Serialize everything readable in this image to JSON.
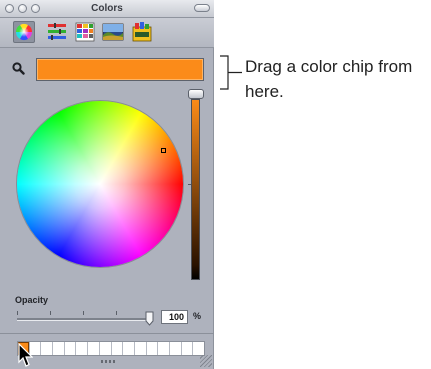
{
  "window": {
    "title": "Colors"
  },
  "toolbar": {
    "tabs": [
      {
        "name": "color-wheel",
        "icon": "color-wheel-icon",
        "selected": true
      },
      {
        "name": "color-sliders",
        "icon": "color-sliders-icon",
        "selected": false
      },
      {
        "name": "color-palettes",
        "icon": "color-palettes-icon",
        "selected": false
      },
      {
        "name": "image-palettes",
        "icon": "image-palettes-icon",
        "selected": false
      },
      {
        "name": "crayons",
        "icon": "crayons-icon",
        "selected": false
      }
    ]
  },
  "current_color": {
    "hex": "#fb8b19",
    "label": "current color swatch"
  },
  "brightness": {
    "level": 1.0
  },
  "opacity": {
    "label": "Opacity",
    "value": "100",
    "unit": "%"
  },
  "swatches": {
    "count": 16,
    "filled_color": "#fb8b19"
  },
  "annotation": {
    "text": "Drag a color chip from here."
  }
}
